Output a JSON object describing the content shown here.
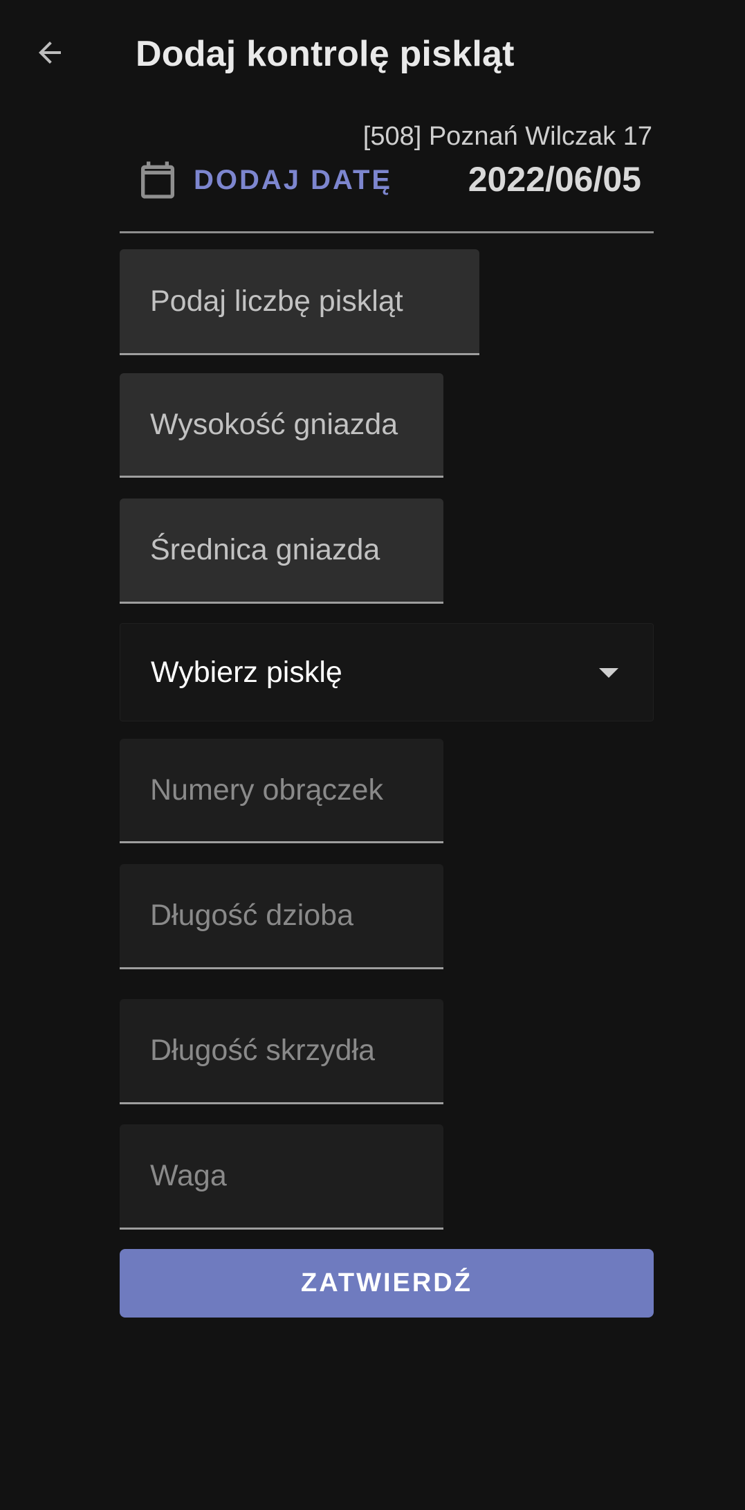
{
  "app_bar": {
    "back_icon": "arrow-left-icon",
    "title": "Dodaj kontrolę piskląt"
  },
  "header": {
    "nest_name": "[508] Poznań Wilczak 17",
    "date_button_icon": "calendar-icon",
    "date_button_label": "DODAJ DATĘ",
    "date_value": "2022/06/05"
  },
  "form": {
    "chick_count_placeholder": "Podaj liczbę piskląt",
    "nest_height_placeholder": "Wysokość gniazda",
    "nest_diameter_placeholder": "Średnica gniazda",
    "chick_select": {
      "selected": "Wybierz pisklę",
      "icon": "dropdown-caret-icon"
    },
    "ring_numbers_placeholder": "Numery obrączek",
    "beak_length_placeholder": "Długość dzioba",
    "wing_length_placeholder": "Długość skrzydła",
    "weight_placeholder": "Waga",
    "submit_label": "ZATWIERDŹ"
  },
  "colors": {
    "background": "#121212",
    "accent": "#7d86cf",
    "submit_background": "#6f7bbf",
    "field_active": "#2e2e2e",
    "field_disabled": "#1e1e1e"
  }
}
